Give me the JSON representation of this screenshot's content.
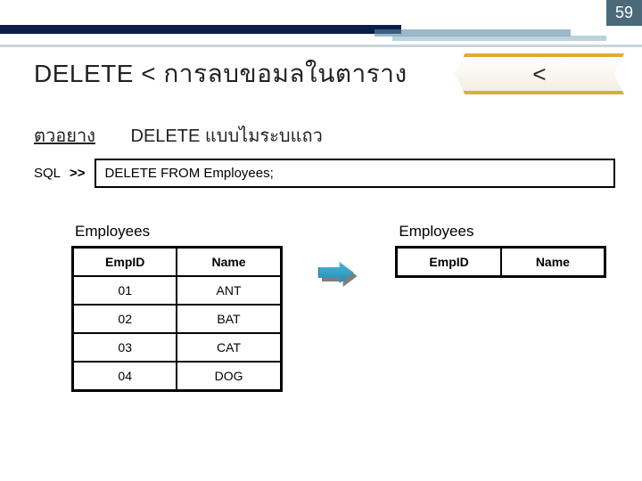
{
  "page_number": "59",
  "title": "DELETE  < การลบขอมลในตาราง",
  "badge_text": "<",
  "subtitle": {
    "label": "ตวอยาง",
    "desc": "DELETE แบบไมระบแถว"
  },
  "sql": {
    "label": "SQL",
    "arrows": ">>",
    "code": "DELETE FROM Employees;"
  },
  "left_table": {
    "title": "Employees",
    "headers": [
      "EmpID",
      "Name"
    ],
    "rows": [
      [
        "01",
        "ANT"
      ],
      [
        "02",
        "BAT"
      ],
      [
        "03",
        "CAT"
      ],
      [
        "04",
        "DOG"
      ]
    ]
  },
  "right_table": {
    "title": "Employees",
    "headers": [
      "EmpID",
      "Name"
    ]
  }
}
